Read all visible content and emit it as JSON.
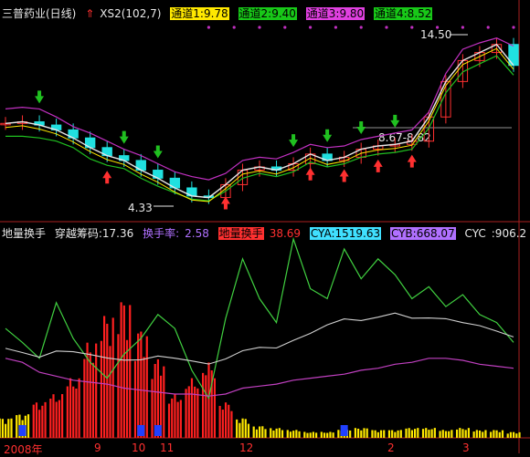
{
  "header": {
    "stock_name": "三普药业(日线)",
    "indicator_name": "XS2(102,7)",
    "tongdao1": "通道1:9.78",
    "tongdao2": "通道2:9.40",
    "tongdao3": "通道3:9.80",
    "tongdao4": "通道4:8.52"
  },
  "lower_header": {
    "title": "地量换手",
    "chip_label": "穿越筹码:17.36",
    "turnover_label": "换手率:",
    "turnover_value": "2.58",
    "low_volume_label": "地量换手",
    "low_volume_value": "38.69",
    "cya": "CYA:1519.63",
    "cyb": "CYB:668.07",
    "cyc": "CYC",
    "cyc_value": ":906.2"
  },
  "annotations": {
    "high": "14.50",
    "low": "4.33",
    "range_line": "8.67-8.82"
  },
  "x_axis": {
    "year": "2008年",
    "ticks": [
      "9",
      "10",
      "11",
      "12",
      "2",
      "3"
    ]
  },
  "colors": {
    "price_white": "#e8e8e8",
    "ma_yellow": "#ffe800",
    "channel_purple": "#c030c0",
    "channel_green": "#20c020",
    "up_candle": "#ff3030",
    "down_candle": "#20e0e0",
    "volume_red": "#ff2020",
    "volume_yellow": "#ffe800",
    "volume_blue": "#2040ff",
    "osc_green": "#40d040",
    "osc_purple": "#c040c0",
    "osc_white": "#d0d0d0"
  },
  "chart_data": [
    {
      "type": "line",
      "x": [
        0,
        1,
        2,
        3,
        4,
        5,
        6,
        7,
        8,
        9,
        10,
        11,
        12,
        13,
        14,
        15,
        16,
        17,
        18,
        19,
        20,
        21,
        22,
        23,
        24,
        25,
        26,
        27,
        28,
        29,
        30
      ],
      "series": [
        {
          "values": [
            9.2,
            9.3,
            9.1,
            8.8,
            8.3,
            7.7,
            7.2,
            6.9,
            6.3,
            5.8,
            5.2,
            4.7,
            4.6,
            5.4,
            6.3,
            6.5,
            6.3,
            6.7,
            7.3,
            6.9,
            7.1,
            7.6,
            7.8,
            7.9,
            8.1,
            9.6,
            11.8,
            13.1,
            13.6,
            14.1,
            12.8
          ]
        },
        {
          "values": [
            10.1,
            10.2,
            10.1,
            9.6,
            9.0,
            8.6,
            8.1,
            7.6,
            7.2,
            6.7,
            6.2,
            5.9,
            5.7,
            6.1,
            6.9,
            7.1,
            7.0,
            7.4,
            7.9,
            7.7,
            7.8,
            8.2,
            8.4,
            8.6,
            8.8,
            9.9,
            12.3,
            13.8,
            14.2,
            14.5,
            14.0
          ]
        },
        {
          "values": [
            8.4,
            8.4,
            8.3,
            8.1,
            7.7,
            7.0,
            6.6,
            6.4,
            5.8,
            5.3,
            4.9,
            4.5,
            4.4,
            5.0,
            5.8,
            6.1,
            5.9,
            6.2,
            6.8,
            6.5,
            6.7,
            7.1,
            7.3,
            7.4,
            7.6,
            8.9,
            11.1,
            12.4,
            12.9,
            13.4,
            12.2
          ]
        }
      ],
      "ylim": [
        3.5,
        15.5
      ]
    },
    {
      "type": "bar",
      "x": [
        0,
        1,
        2,
        3,
        4,
        5,
        6,
        7,
        8,
        9,
        10,
        11,
        12,
        13,
        14,
        15,
        16,
        17,
        18,
        19,
        20,
        21,
        22,
        23,
        24,
        25,
        26,
        27,
        28,
        29,
        30
      ],
      "series": [
        {
          "values": [
            10,
            12,
            18,
            22,
            30,
            48,
            62,
            70,
            55,
            40,
            22,
            30,
            38,
            18,
            10,
            6,
            5,
            4,
            3,
            3,
            4,
            5,
            4,
            4,
            5,
            5,
            4,
            5,
            4,
            4,
            3
          ]
        },
        {
          "values": [
            55,
            48,
            40,
            68,
            50,
            38,
            30,
            42,
            50,
            62,
            55,
            34,
            20,
            60,
            90,
            70,
            58,
            100,
            75,
            70,
            95,
            80,
            90,
            82,
            70,
            76,
            66,
            72,
            62,
            58,
            48
          ]
        },
        {
          "values": [
            40,
            38,
            33,
            31,
            29,
            28,
            27,
            25,
            24,
            23,
            22,
            22,
            21,
            22,
            25,
            26,
            27,
            29,
            30,
            31,
            32,
            34,
            35,
            37,
            38,
            40,
            40,
            39,
            37,
            36,
            35
          ]
        }
      ],
      "ylim": [
        0,
        100
      ]
    }
  ]
}
